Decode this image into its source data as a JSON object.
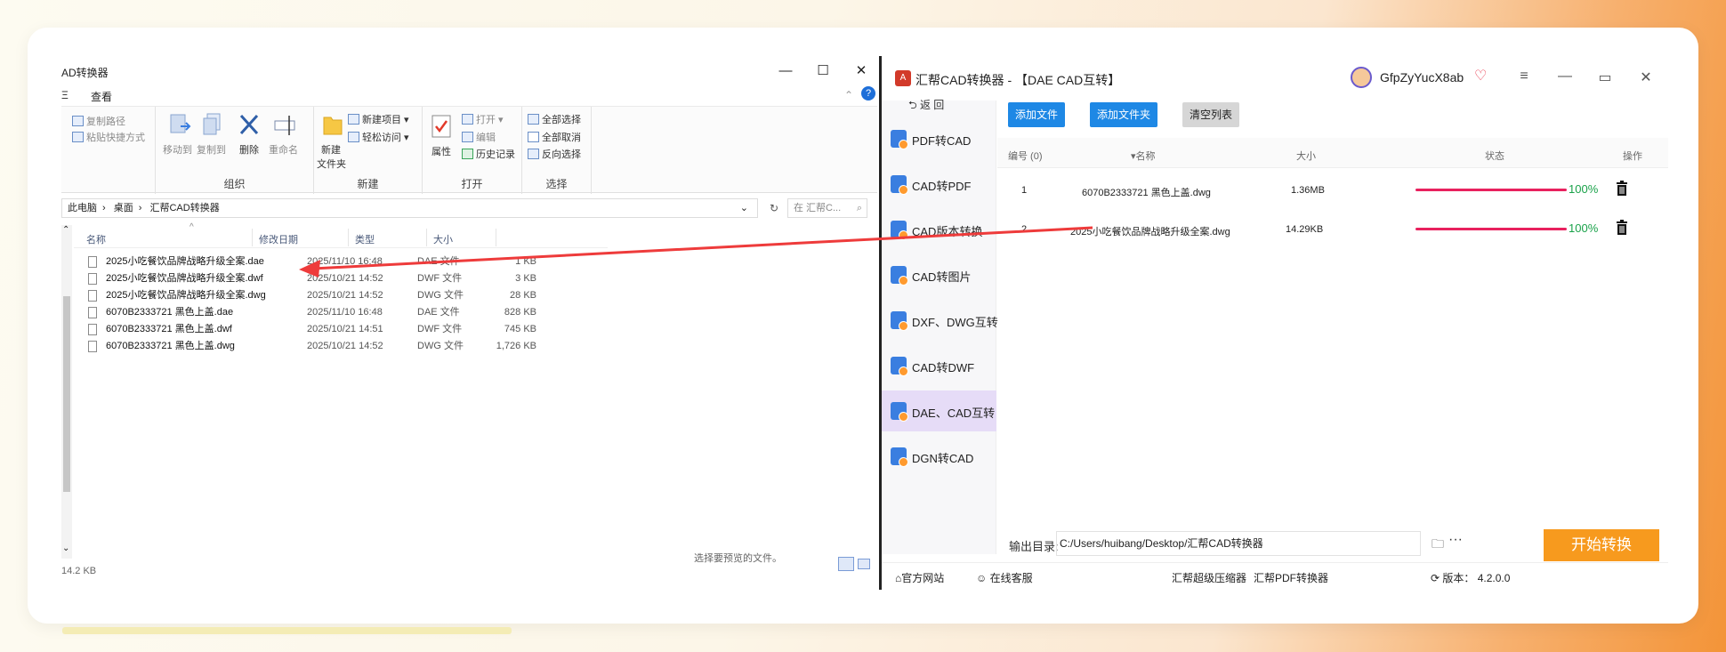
{
  "explorer": {
    "title": "AD转换器",
    "tab_cut": "Ξ",
    "tab_view": "查看",
    "ribbon": {
      "copy_path": "复制路径",
      "paste_shortcut": "粘贴快捷方式",
      "move_to": "移动到",
      "copy_to": "复制到",
      "delete": "删除",
      "rename": "重命名",
      "group_organize": "组织",
      "new_folder_line1": "新建",
      "new_folder_line2": "文件夹",
      "new_item": "新建项目",
      "easy_access": "轻松访问",
      "group_new": "新建",
      "properties": "属性",
      "open": "打开",
      "edit": "编辑",
      "history": "历史记录",
      "group_open": "打开",
      "select_all": "全部选择",
      "select_none": "全部取消",
      "invert_select": "反向选择",
      "group_select": "选择"
    },
    "breadcrumb": [
      "此电脑",
      "桌面",
      "汇帮CAD转换器"
    ],
    "search_placeholder": "在 汇帮C...",
    "columns": {
      "name": "名称",
      "date": "修改日期",
      "type": "类型",
      "size": "大小"
    },
    "files": [
      {
        "name": "2025小吃餐饮品牌战略升级全案.dae",
        "date": "2025/11/10 16:48",
        "type": "DAE 文件",
        "size": "1 KB"
      },
      {
        "name": "2025小吃餐饮品牌战略升级全案.dwf",
        "date": "2025/10/21 14:52",
        "type": "DWF 文件",
        "size": "3 KB"
      },
      {
        "name": "2025小吃餐饮品牌战略升级全案.dwg",
        "date": "2025/10/21 14:52",
        "type": "DWG 文件",
        "size": "28 KB"
      },
      {
        "name": "6070B2333721 黑色上盖.dae",
        "date": "2025/11/10 16:48",
        "type": "DAE 文件",
        "size": "828 KB"
      },
      {
        "name": "6070B2333721 黑色上盖.dwf",
        "date": "2025/10/21 14:51",
        "type": "DWF 文件",
        "size": "745 KB"
      },
      {
        "name": "6070B2333721 黑色上盖.dwg",
        "date": "2025/10/21 14:52",
        "type": "DWG 文件",
        "size": "1,726 KB"
      }
    ],
    "preview_message": "选择要预览的文件。",
    "status": "14.2 KB"
  },
  "app": {
    "title": "汇帮CAD转换器 - 【DAE CAD互转】",
    "username": "GfpZyYucX8ab",
    "back_label": "返 回",
    "sidebar_items": [
      "PDF转CAD",
      "CAD转PDF",
      "CAD版本转换",
      "CAD转图片",
      "DXF、DWG互转",
      "CAD转DWF",
      "DAE、CAD互转",
      "DGN转CAD"
    ],
    "active_item": "DAE、CAD互转",
    "toolbar": {
      "add_file": "添加文件",
      "add_folder": "添加文件夹",
      "clear_list": "清空列表"
    },
    "table_headers": {
      "index": "编号 (0)",
      "name": "名称",
      "size": "大小",
      "status": "状态",
      "action": "操作"
    },
    "rows": [
      {
        "index": "1",
        "name": "6070B2333721 黑色上盖.dwg",
        "size": "1.36MB",
        "progress": 1.0,
        "percent": "100%"
      },
      {
        "index": "2",
        "name": "2025小吃餐饮品牌战略升级全案.dwg",
        "size": "14.29KB",
        "progress": 1.0,
        "percent": "100%"
      }
    ],
    "output_label": "输出目录:",
    "output_path": "C:/Users/huibang/Desktop/汇帮CAD转换器",
    "start_button": "开始转换",
    "footer": {
      "official_site": "官方网站",
      "online_service": "在线客服",
      "compressor": "汇帮超级压缩器",
      "pdf_converter": "汇帮PDF转换器",
      "version": "版本： 4.2.0.0"
    },
    "colors": {
      "accent_blue": "#1e88e5",
      "start_orange": "#f79a1e",
      "progress_pink": "#e8215e",
      "percent_green": "#1aa24a",
      "active_bg": "#e6dcf7"
    }
  }
}
